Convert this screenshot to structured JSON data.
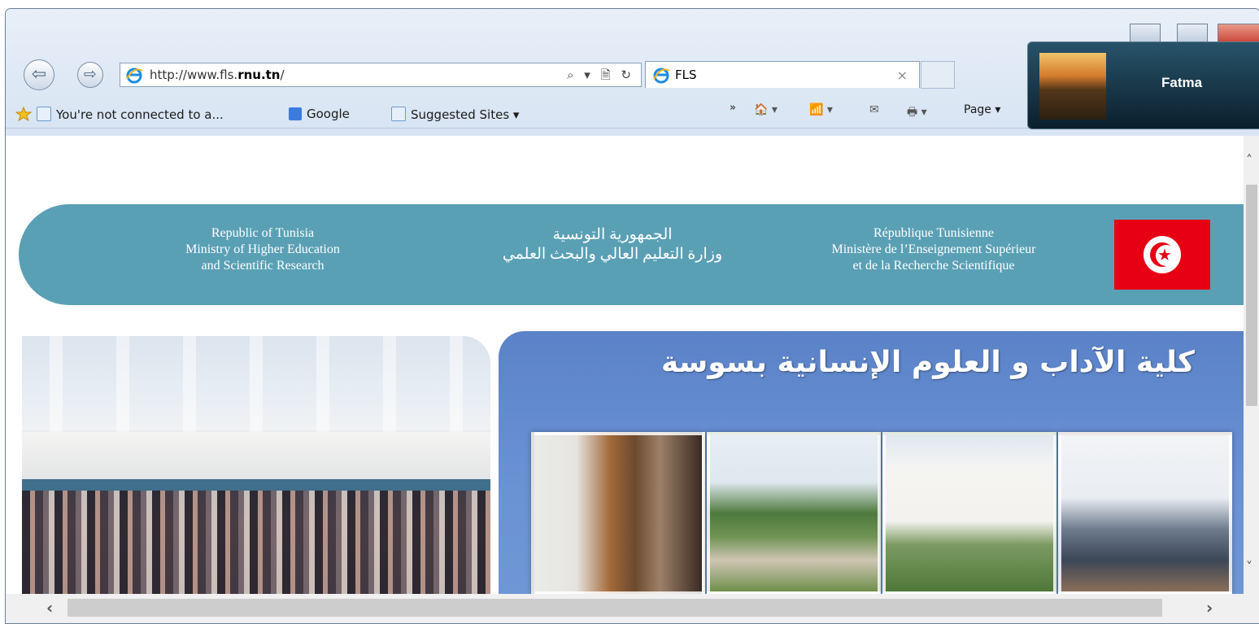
{
  "browser": {
    "address_url_prefix": "http://www.fls.",
    "address_url_bold": "rnu.tn",
    "address_url_suffix": "/",
    "address_tools": "⌕ ▾ 🗎 ↻",
    "tab_title": "FLS",
    "tab_close": "×"
  },
  "favorites": {
    "items": [
      {
        "label": "You're not connected to a...",
        "icon": "ie-page-icon"
      },
      {
        "label": "Google",
        "icon": "google-icon"
      },
      {
        "label": "Suggested Sites ▾",
        "icon": "ie-page-icon"
      }
    ],
    "overflow": "»"
  },
  "commandbar": {
    "home": "🏠 ▾",
    "feeds": "📶 ▾",
    "mail": "✉",
    "print": "🖶 ▾",
    "page": "Page ▾"
  },
  "profile": {
    "name": "Fatma"
  },
  "site": {
    "en_text": "Republic of Tunisia\nMinistry of Higher Education\nand Scientific Research",
    "ar_text": "الجمهورية التونسية\nوزارة التعليم العالي والبحث العلمي",
    "fr_text": "République Tunisienne\nMinistère de l’Enseignement Supérieur\net de la Recherche Scientifique",
    "college_title": "كلية الآداب و العلوم الإنسانية بسوسة"
  },
  "colors": {
    "banner": "#5aa0b5",
    "panel": "#5b82c8",
    "flag_red": "#e70013"
  },
  "scrollbars": {
    "up": "˄",
    "down": "˅",
    "left": "‹",
    "right": "›"
  }
}
